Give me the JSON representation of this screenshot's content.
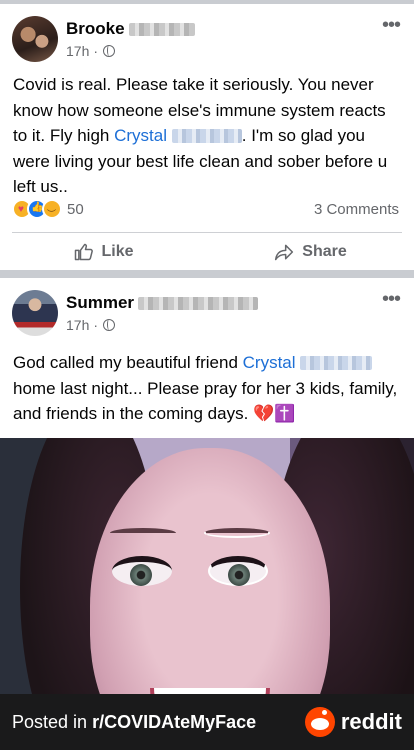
{
  "post1": {
    "author": "Brooke",
    "time": "17h",
    "visibility_icon": "globe-icon",
    "text_before": "Covid is real. Please take it seriously. You never know how someone else's immune system reacts to it. Fly high ",
    "mention": "Crystal",
    "text_after": ". I'm so glad you were living your best life clean and sober before u left us..",
    "reaction_count": "50",
    "comments": "3 Comments",
    "like_label": "Like",
    "share_label": "Share"
  },
  "post2": {
    "author": "Summer",
    "time": "17h",
    "visibility_icon": "globe-icon",
    "text_before": "God called my beautiful friend ",
    "mention": "Crystal",
    "text_after": " home last night... Please pray for her 3 kids, family, and friends in the coming days. 💔✝️"
  },
  "footer": {
    "posted_prefix": "Posted in ",
    "subreddit": "r/COVIDAteMyFace",
    "brand": "reddit"
  },
  "colors": {
    "link": "#1d6fd6",
    "reddit_orange": "#ff4500",
    "footer_bg": "#1a1a1b"
  }
}
